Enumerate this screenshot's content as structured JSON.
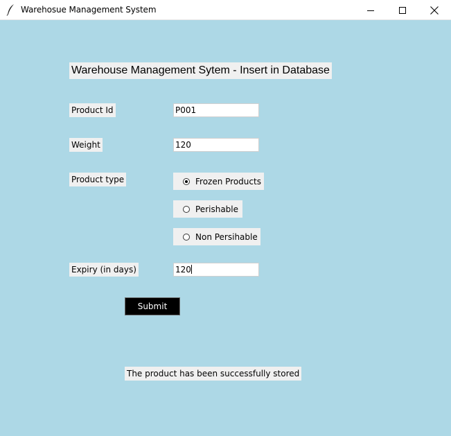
{
  "window": {
    "title": "Warehosue Management System",
    "icon": "feather-icon",
    "controls": [
      "minimize-icon",
      "maximize-icon",
      "close-icon"
    ]
  },
  "colors": {
    "background": "#add8e6",
    "label_bg": "#f0f0f0",
    "button_bg": "#000000",
    "button_fg": "#ffffff"
  },
  "form": {
    "heading": "Warehouse Management Sytem - Insert in Database",
    "product_id": {
      "label": "Product Id",
      "value": "P001"
    },
    "weight": {
      "label": "Weight",
      "value": "120"
    },
    "product_type": {
      "label": "Product type",
      "options": [
        "Frozen Products",
        "Perishable",
        "Non Persihable"
      ],
      "selected": "Frozen Products"
    },
    "expiry": {
      "label": "Expiry (in days)",
      "value": "120"
    },
    "submit_label": "Submit"
  },
  "status": {
    "message": "The product has been successfully stored"
  }
}
